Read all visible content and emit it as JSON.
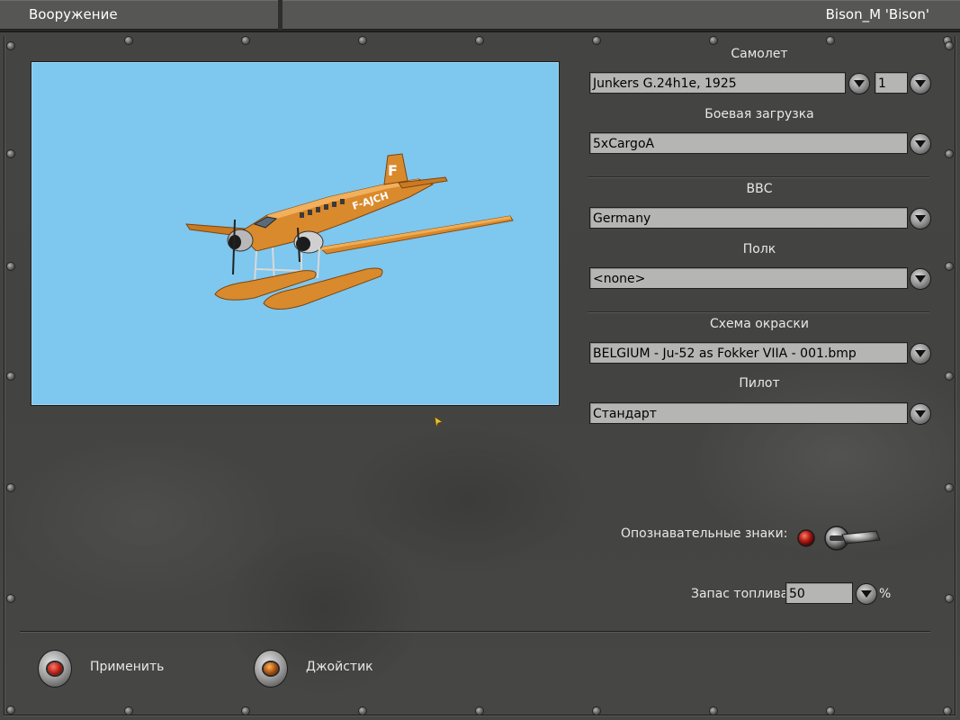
{
  "header": {
    "title": "Вооружение",
    "pilot_name": "Bison_M 'Bison'"
  },
  "preview": {
    "aircraft_marking_tail": "F",
    "aircraft_marking_fuselage": "F-AJCH",
    "colors": {
      "sky": "#7ec7ef",
      "aircraft": "#d98a2c"
    }
  },
  "form": {
    "aircraft": {
      "label": "Самолет",
      "value": "Junkers G.24h1e,  1925",
      "count": "1"
    },
    "loadout": {
      "label": "Боевая загрузка",
      "value": "5xCargoA"
    },
    "air_force": {
      "label": "ВВС",
      "value": "Germany"
    },
    "regiment": {
      "label": "Полк",
      "value": "<none>"
    },
    "skin": {
      "label": "Схема окраски",
      "value": "BELGIUM - Ju-52 as Fokker VIIA - 001.bmp"
    },
    "pilot": {
      "label": "Пилот",
      "value": "Стандарт"
    },
    "markings": {
      "label": "Опознавательные знаки:",
      "enabled": true
    },
    "fuel": {
      "label": "Запас топлива",
      "value": "50",
      "unit": "%"
    }
  },
  "footer": {
    "apply_label": "Применить",
    "joystick_label": "Джойстик"
  }
}
